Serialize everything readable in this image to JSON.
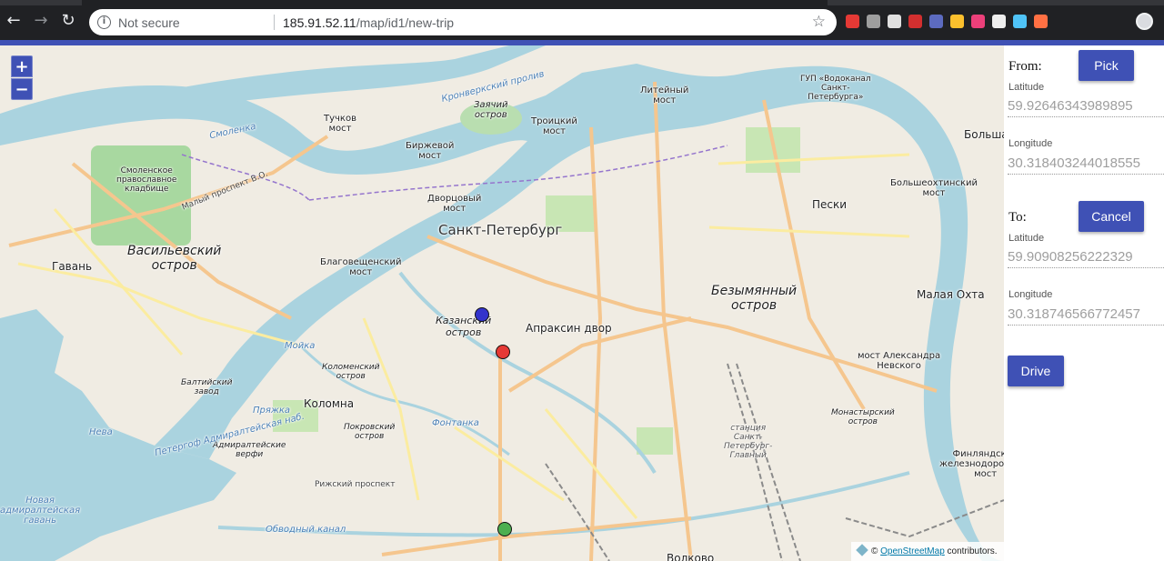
{
  "browser": {
    "security_label": "Not secure",
    "url_host": "185.91.52.11",
    "url_path": "/map/id1/new-trip",
    "extensions": [
      {
        "name": "adblock-icon",
        "color": "#e53935"
      },
      {
        "name": "circle-ext-icon",
        "color": "#9e9e9e"
      },
      {
        "name": "jb-ext-icon",
        "color": "#e0e0e0"
      },
      {
        "name": "pdf-ext-icon",
        "color": "#d32f2f"
      },
      {
        "name": "shield-ext-icon",
        "color": "#5c6bc0"
      },
      {
        "name": "clock-ext-icon",
        "color": "#fbc02d"
      },
      {
        "name": "gradient-ext-icon",
        "color": "#ec407a"
      },
      {
        "name": "list-ext-icon",
        "color": "#eeeeee"
      },
      {
        "name": "cube-ext-icon",
        "color": "#4fc3f7"
      },
      {
        "name": "fire-ext-icon",
        "color": "#ff7043"
      }
    ]
  },
  "map": {
    "zoom_in_label": "+",
    "zoom_out_label": "−",
    "attribution_prefix": "©",
    "attribution_link": "OpenStreetMap",
    "attribution_suffix": "contributors.",
    "labels": {
      "spb": "Санкт-Петербург",
      "vasilyevsky": "Васильевский\nостров",
      "bezymyanny": "Безымянный\nостров",
      "gavan": "Гавань",
      "malaya_okhta": "Малая Охта",
      "peski": "Пески",
      "kolomna": "Коломна",
      "apraksin": "Апраксин двор",
      "kazansky": "Казанский\nостров",
      "zayachy": "Заячий\nостров",
      "tuchkov": "Тучков\nмост",
      "birzhevoy": "Биржевой\nмост",
      "dvortsovy": "Дворцовый\nмост",
      "troitsky": "Троицкий\nмост",
      "liteyny": "Литейный\nмост",
      "blagoveshchensky": "Благовещенский\nмост",
      "bolsheokhtinsky": "Большеохтинский\nмост",
      "alexander_nevsky": "мост Александра\nНевского",
      "finlyandsky": "Финляндский\nжелезнодорожный\nмост",
      "vodokanal": "ГУП «Водоканал\nСанкт-\nПетербурга»",
      "smolenskoye": "Смоленское\nправославное\nкладбище",
      "baltiysky": "Балтийский\nзавод",
      "kolomensky": "Коломенский\nостров",
      "pokrovsky": "Покровский\nостров",
      "admiralteyskie": "Адмиралтейские\nверфи",
      "monastyrsky": "Монастырский\nостров",
      "station": "станция\nСанкт-\nПетербург-\nГлавный",
      "novaya_gavan": "Новая\nадмиралтейская\nгавань",
      "neva": "Нева",
      "bolshaya": "Больша",
      "volkovo": "Волково",
      "fontanka": "Фонтанка",
      "moika": "Мойка",
      "pryazhka": "Пряжка",
      "obvodny": "Обводный канал",
      "ryazhsky": "Рижский проспект",
      "maly_prospekt": "Малый проспект В.О.",
      "smolenka": "Смоленка",
      "kronverksky": "Кронверкский пролив",
      "petergof": "Петергоф Адмиралтейская наб."
    },
    "markers": {
      "from_color": "#3333cc",
      "to_color": "#e53935",
      "current_color": "#4caf50"
    }
  },
  "panel": {
    "from_label": "From:",
    "pick_label": "Pick",
    "from_latitude_label": "Latitude",
    "from_latitude_value": "59.92646343989895",
    "from_longitude_label": "Longitude",
    "from_longitude_value": "30.318403244018555",
    "to_label": "To:",
    "cancel_label": "Cancel",
    "to_latitude_label": "Latitude",
    "to_latitude_value": "59.90908256222329",
    "to_longitude_label": "Longitude",
    "to_longitude_value": "30.318746566772457",
    "drive_label": "Drive"
  },
  "colors": {
    "accent": "#3f51b5",
    "water": "#aad3df",
    "park": "#c8e6b4",
    "land": "#f2efe9"
  }
}
